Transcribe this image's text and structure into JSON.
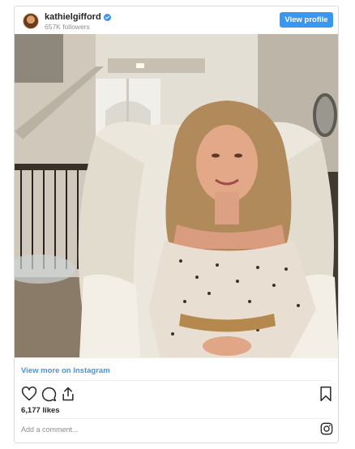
{
  "post": {
    "username": "kathielgifford",
    "followers": "657K followers",
    "view_profile_label": "View profile",
    "view_more_label": "View more on Instagram",
    "likes": "6,177 likes",
    "comment_placeholder": "Add a comment...",
    "photo_description_icon": "photo-of-woman-in-white-armchair"
  },
  "colors": {
    "accent": "#3897f0",
    "muted": "#8e8e8e",
    "text": "#262626",
    "border": "#dbdbdb"
  },
  "icons": [
    "verified-badge-icon",
    "heart-icon",
    "comment-icon",
    "share-icon",
    "bookmark-icon",
    "instagram-icon"
  ]
}
